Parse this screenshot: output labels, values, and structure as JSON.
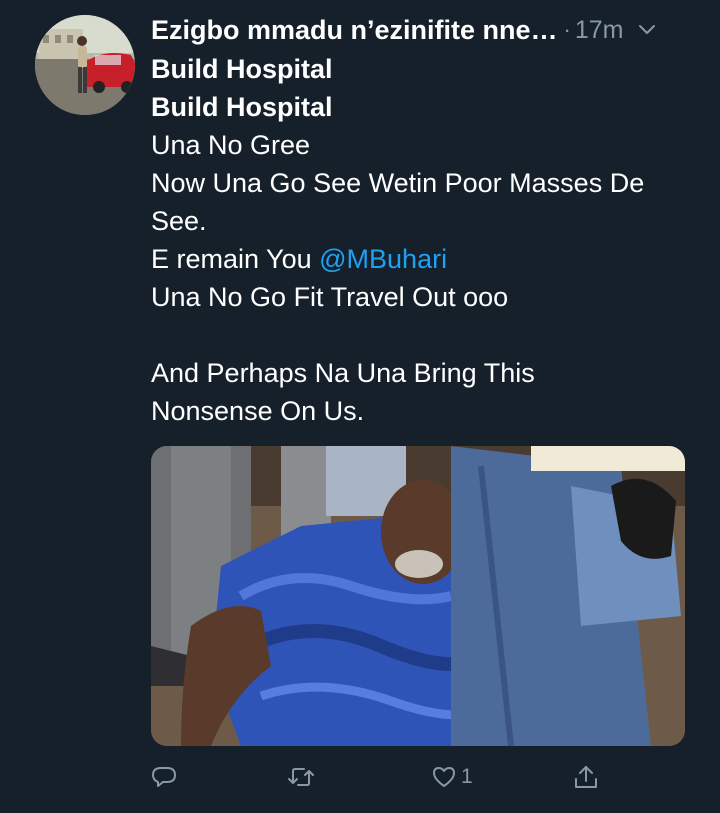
{
  "tweet": {
    "author_name": "Ezigbo mmadu n’ezinifite nne…",
    "separator": "·",
    "time": "17m",
    "lines": [
      "Build Hospital",
      "Build Hospital",
      "Una No Gree",
      "Now Una Go See Wetin Poor Masses De",
      "See.",
      "E remain You ",
      "Una No Go Fit Travel Out ooo",
      "",
      "And Perhaps Na Una Bring This",
      "Nonsense On Us."
    ],
    "mention": "@MBuhari",
    "likes": "1"
  },
  "actions": {
    "icons": [
      "reply-icon",
      "retweet-icon",
      "like-icon",
      "share-icon"
    ]
  },
  "colors": {
    "background": "#15202b",
    "text": "#ffffff",
    "secondary": "#8899a6",
    "link": "#1da1f2"
  }
}
